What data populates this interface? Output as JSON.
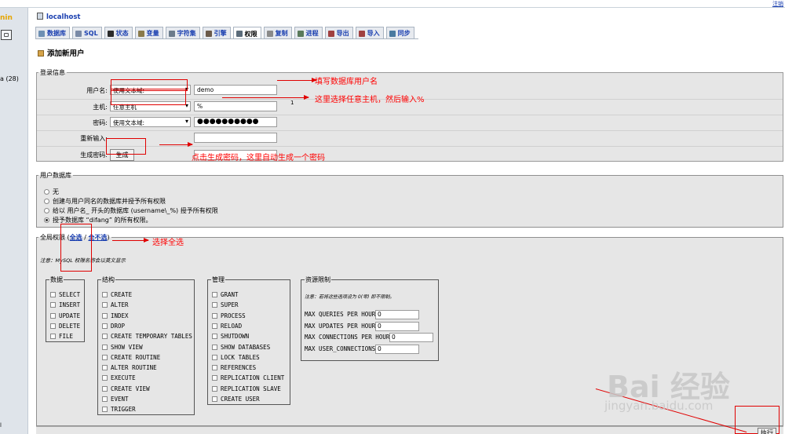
{
  "topbar": {
    "logout": "注销"
  },
  "left": {
    "logo_fragment": "nin",
    "db_entry": "a (28)",
    "bottom_text": "l"
  },
  "server": {
    "name": "localhost"
  },
  "tabs": [
    {
      "label": "数据库",
      "color": "#6d8fb3"
    },
    {
      "label": "SQL",
      "color": "#7a8aa6"
    },
    {
      "label": "状态",
      "color": "#2b2b2b"
    },
    {
      "label": "变量",
      "color": "#8a7a4a"
    },
    {
      "label": "字符集",
      "color": "#6b7b8b"
    },
    {
      "label": "引擎",
      "color": "#6b5a4a"
    },
    {
      "label": "权限",
      "color": "#5a6b7a",
      "active": true
    },
    {
      "label": "复制",
      "color": "#8a8a8a"
    },
    {
      "label": "进程",
      "color": "#5a7a5a"
    },
    {
      "label": "导出",
      "color": "#a04040"
    },
    {
      "label": "导入",
      "color": "#a04040"
    },
    {
      "label": "同步",
      "color": "#4a7aa0"
    }
  ],
  "page_title": "添加新用户",
  "login_info": {
    "legend": "登录信息",
    "username_label": "用户名:",
    "username_select": "使用文本域:",
    "username_value": "demo",
    "host_label": "主机:",
    "host_select": "任意主机",
    "host_value": "%",
    "host_note": "1",
    "password_label": "密码:",
    "password_select": "使用文本域:",
    "password_value": "●●●●●●●●●●",
    "reenter_label": "重新输入:",
    "generate_label": "生成密码:",
    "generate_button": "生成"
  },
  "annotations": {
    "fill_username": "填写数据库用户名",
    "choose_host": "这里选择任意主机，然后输入%",
    "generate_note": "点击生成密码，这里自动生成一个密码",
    "select_all": "选择全选"
  },
  "user_db": {
    "legend": "用户数据库",
    "options": [
      "无",
      "创建与用户同名的数据库并授予所有权限",
      "给以 用户名_ 开头的数据库 (username\\_%) 授予所有权限",
      "授予数据库 “difang” 的所有权限。"
    ],
    "selected_index": 3
  },
  "global_priv": {
    "legend_prefix": "全局权限 (",
    "check_all": "全选",
    "sep": " / ",
    "uncheck_all": "全不选",
    "legend_suffix": ")",
    "note": "注意：MySQL 权限名称会以英文显示",
    "groups": [
      {
        "title": "数据",
        "items": [
          "SELECT",
          "INSERT",
          "UPDATE",
          "DELETE",
          "FILE"
        ]
      },
      {
        "title": "结构",
        "items": [
          "CREATE",
          "ALTER",
          "INDEX",
          "DROP",
          "CREATE TEMPORARY TABLES",
          "SHOW VIEW",
          "CREATE ROUTINE",
          "ALTER ROUTINE",
          "EXECUTE",
          "CREATE VIEW",
          "EVENT",
          "TRIGGER"
        ]
      },
      {
        "title": "管理",
        "items": [
          "GRANT",
          "SUPER",
          "PROCESS",
          "RELOAD",
          "SHUTDOWN",
          "SHOW DATABASES",
          "LOCK TABLES",
          "REFERENCES",
          "REPLICATION CLIENT",
          "REPLICATION SLAVE",
          "CREATE USER"
        ]
      }
    ],
    "limits": {
      "title": "资源限制",
      "note": "注意：若将这些选项设为 0(零) 即不限制。",
      "items": [
        {
          "label": "MAX QUERIES PER HOUR",
          "value": "0"
        },
        {
          "label": "MAX UPDATES PER HOUR",
          "value": "0"
        },
        {
          "label": "MAX CONNECTIONS PER HOUR",
          "value": "0"
        },
        {
          "label": "MAX USER_CONNECTIONS",
          "value": "0"
        }
      ]
    }
  },
  "execute_button": "执行",
  "watermark": {
    "main": "Bai 经验",
    "sub": "jingyan.baidu.com"
  }
}
